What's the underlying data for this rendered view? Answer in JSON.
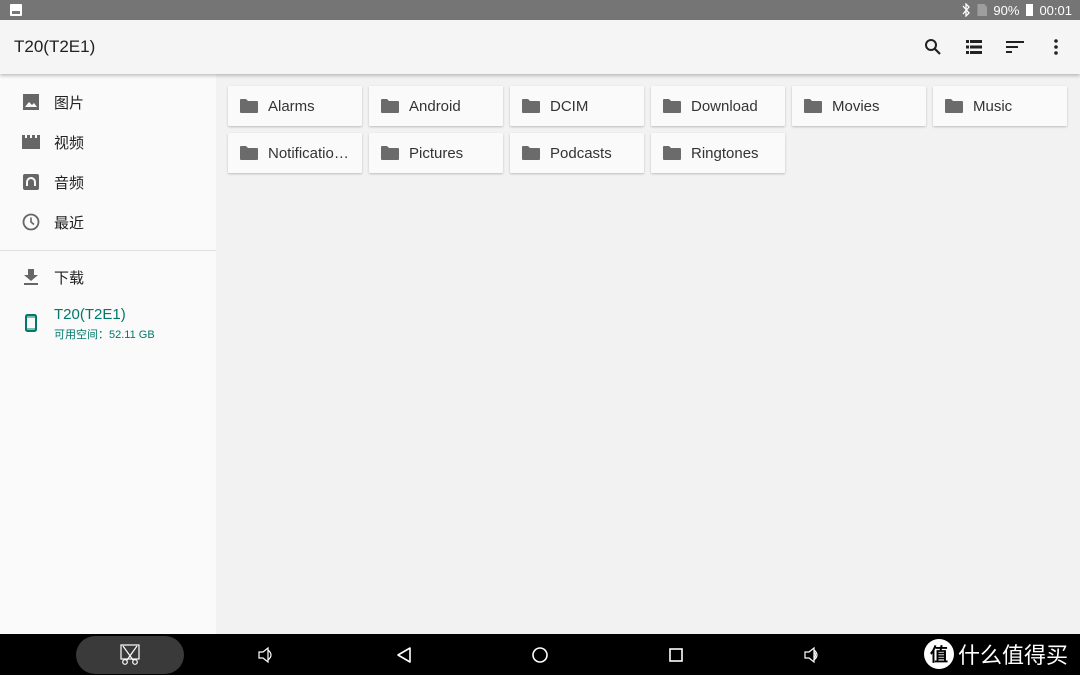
{
  "status_bar": {
    "battery": "90%",
    "time": "00:01",
    "icons": [
      "image-notification-icon",
      "bluetooth-icon",
      "no-sim-icon",
      "battery-icon"
    ]
  },
  "app_bar": {
    "title": "T20(T2E1)",
    "actions": [
      {
        "name": "search-icon",
        "label": "Search"
      },
      {
        "name": "list-view-icon",
        "label": "List view"
      },
      {
        "name": "sort-icon",
        "label": "Sort"
      },
      {
        "name": "more-vert-icon",
        "label": "More options"
      }
    ]
  },
  "sidebar": {
    "items": [
      {
        "label": "图片",
        "icon": "image-icon"
      },
      {
        "label": "视频",
        "icon": "video-icon"
      },
      {
        "label": "音频",
        "icon": "audio-icon"
      },
      {
        "label": "最近",
        "icon": "clock-icon"
      },
      {
        "label": "下载",
        "icon": "download-icon"
      }
    ],
    "storage": {
      "label": "T20(T2E1)",
      "subtitle": "可用空间：52.11 GB",
      "icon": "phone-icon",
      "accent": "#00796b"
    }
  },
  "folders": [
    {
      "name": "Alarms"
    },
    {
      "name": "Android"
    },
    {
      "name": "DCIM"
    },
    {
      "name": "Download"
    },
    {
      "name": "Movies"
    },
    {
      "name": "Music"
    },
    {
      "name": "Notificatio…"
    },
    {
      "name": "Pictures"
    },
    {
      "name": "Podcasts"
    },
    {
      "name": "Ringtones"
    }
  ],
  "nav_bar": {
    "buttons": [
      "screenshot-icon",
      "volume-down-icon",
      "back-icon",
      "home-icon",
      "recents-icon",
      "volume-up-icon"
    ]
  },
  "watermark": {
    "logo": "值",
    "text": "什么值得买"
  }
}
